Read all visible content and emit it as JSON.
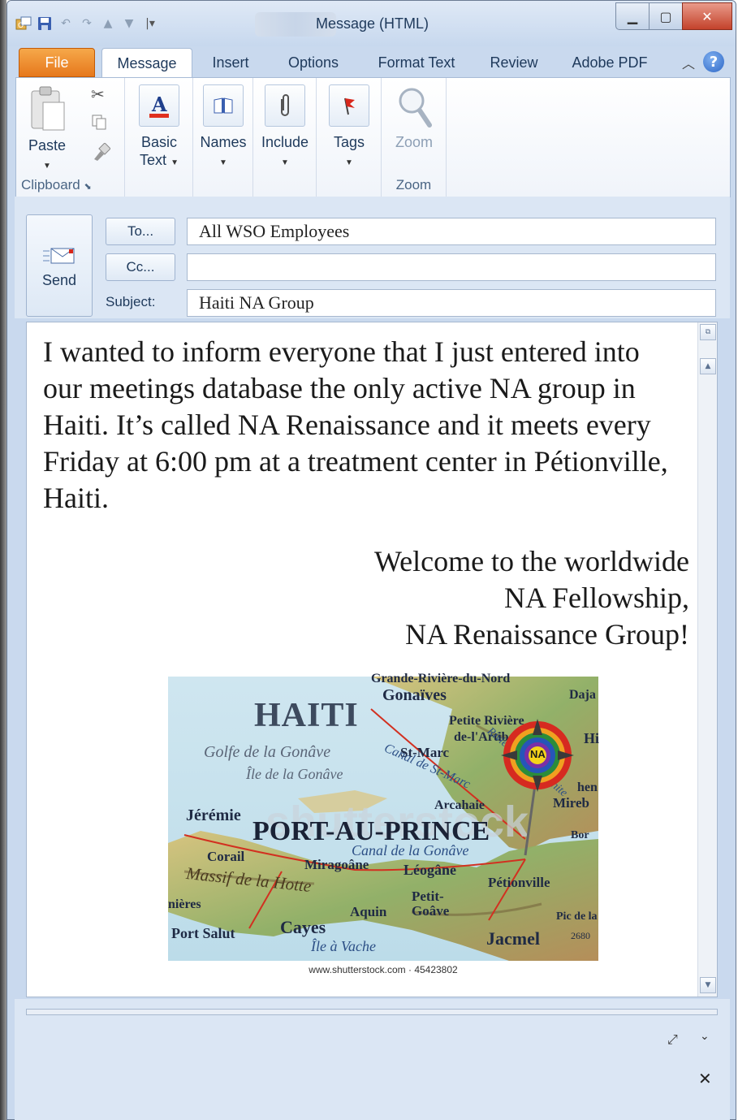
{
  "window": {
    "title": "Message (HTML)",
    "minimize_glyph": "▁",
    "maximize_glyph": "▢",
    "close_glyph": "✕"
  },
  "tabs": {
    "file": "File",
    "message": "Message",
    "insert": "Insert",
    "options": "Options",
    "format_text": "Format Text",
    "review": "Review",
    "adobe_pdf": "Adobe PDF",
    "help_glyph": "?"
  },
  "ribbon": {
    "paste": "Paste",
    "clipboard": "Clipboard",
    "basic_text_line1": "Basic",
    "basic_text_line2": "Text",
    "names": "Names",
    "include": "Include",
    "tags": "Tags",
    "zoom_button": "Zoom",
    "zoom_group": "Zoom"
  },
  "compose": {
    "send": "Send",
    "to_button": "To...",
    "cc_button": "Cc...",
    "subject_label": "Subject:",
    "to_value": "All WSO Employees",
    "cc_value": "",
    "subject_value": "Haiti NA Group"
  },
  "body": {
    "paragraph": "I wanted to inform everyone that I just entered into our meetings database the only active NA group in Haiti. It’s called NA Renaissance and it meets every Friday at 6:00 pm at a treatment center in Pétionville, Haiti.",
    "signoff_1": "Welcome to the worldwide",
    "signoff_2": "NA Fellowship,",
    "signoff_3": "NA Renaissance Group!"
  },
  "map": {
    "title": "HAITI",
    "capital": "PORT-AU-PRINCE",
    "watermark": "shutterstock",
    "labels": {
      "grande_riviere": "Grande-Rivière-du-Nord",
      "gonaives": "Gonaïves",
      "daja": "Daja",
      "petite_riviere": "Petite Rivière",
      "de_l_artibonite": "de-l'Artibonite",
      "golfe": "Golfe de la Gonâve",
      "ile_gonave": "Île de la Gonâve",
      "st_marc": "St-Marc",
      "canal_st_marc": "Canal de St-Marc",
      "riviere_artibonite": "Rivière de l'Artibonite",
      "hi": "Hi",
      "hen": "hen",
      "mirb": "Mireb",
      "arcahaie": "Arcahaie",
      "jeremie": "Jérémie",
      "bor": "Bor",
      "corail": "Corail",
      "miragoane": "Miragoâne",
      "canal_gonave": "Canal de la Gonâve",
      "massif": "Massif de la Hotte",
      "leogane": "Léogâne",
      "petionville": "Pétionville",
      "petit_goave": "Petit-Goâve",
      "aquin": "Aquin",
      "anieres": "nières",
      "port_salut": "Port Salut",
      "cayes": "Cayes",
      "ile_vache": "Île à Vache",
      "jacmel": "Jacmel",
      "pic": "Pic de la",
      "elev": "2680",
      "na_logo": "NA"
    },
    "caption": "www.shutterstock.com · 45423802"
  },
  "icons": {
    "qat_save": "save-icon",
    "qat_undo": "undo-icon",
    "qat_redo": "redo-icon"
  }
}
